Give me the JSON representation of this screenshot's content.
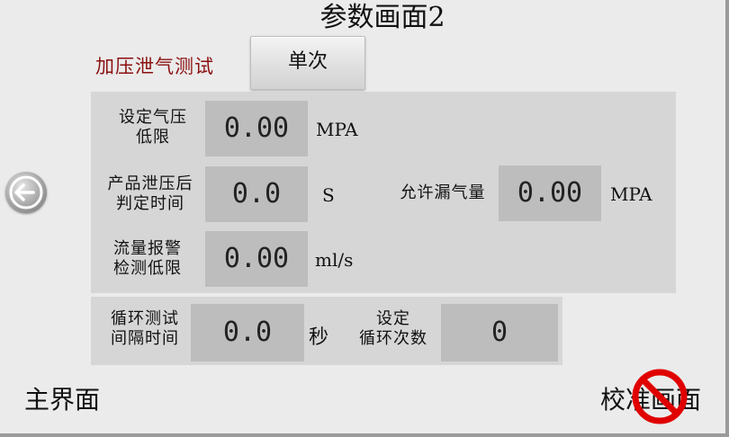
{
  "title": "参数画面2",
  "test_mode": {
    "label": "加压泄气测试",
    "button": "单次"
  },
  "params": {
    "pressure_low": {
      "label_1": "设定气压",
      "label_2": "低限",
      "value": "0.00",
      "unit": "MPA"
    },
    "relief_time": {
      "label_1": "产品泄压后",
      "label_2": "判定时间",
      "value": "0.0",
      "unit": "S"
    },
    "leak_allowed": {
      "label": "允许漏气量",
      "value": "0.00",
      "unit": "MPA"
    },
    "flow_alarm": {
      "label_1": "流量报警",
      "label_2": "检测低限",
      "value": "0.00",
      "unit": "ml/s"
    }
  },
  "cycle": {
    "interval": {
      "label_1": "循环测试",
      "label_2": "间隔时间",
      "value": "0.0",
      "unit": "秒"
    },
    "count": {
      "label_1": "设定",
      "label_2": "循环次数",
      "value": "0"
    }
  },
  "nav": {
    "main": "主界面",
    "calibration": "校准画面"
  },
  "colors": {
    "mode_label": "#8b1010",
    "prohibited": "#e00000"
  }
}
